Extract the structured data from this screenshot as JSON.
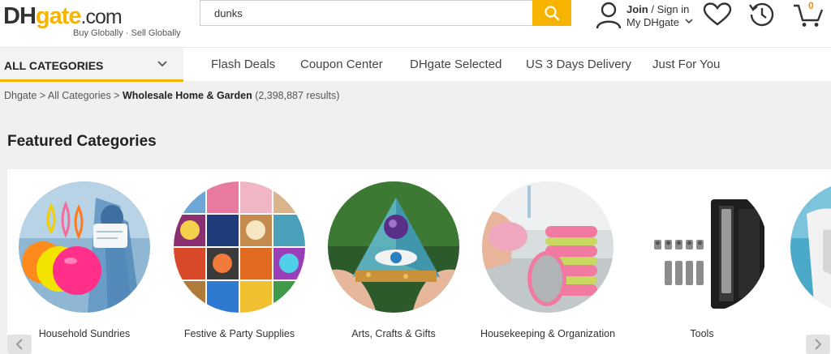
{
  "header": {
    "logo_dh": "DH",
    "logo_gate": "gate",
    "logo_com": ".com",
    "tagline": "Buy Globally · Sell Globally",
    "search_value": "dunks",
    "join": "Join",
    "sign_in": " / Sign in",
    "my_dhgate": "My DHgate",
    "cart_count": "0",
    "accent_color": "#f6b400"
  },
  "nav": {
    "all_categories": "ALL CATEGORIES",
    "items": [
      "Flash Deals",
      "Coupon Center",
      "DHgate Selected",
      "US 3 Days Delivery",
      "Just For You"
    ]
  },
  "breadcrumb": {
    "home": "Dhgate",
    "sep1": " > ",
    "all": "All Categories",
    "sep2": " > ",
    "current": "Wholesale Home & Garden",
    "results": " (2,398,887 results)"
  },
  "featured": {
    "title": "Featured Categories",
    "categories": [
      {
        "name": "Household Sundries"
      },
      {
        "name": "Festive & Party Supplies"
      },
      {
        "name": "Arts, Crafts & Gifts"
      },
      {
        "name": "Housekeeping & Organization"
      },
      {
        "name": "Tools"
      }
    ]
  }
}
